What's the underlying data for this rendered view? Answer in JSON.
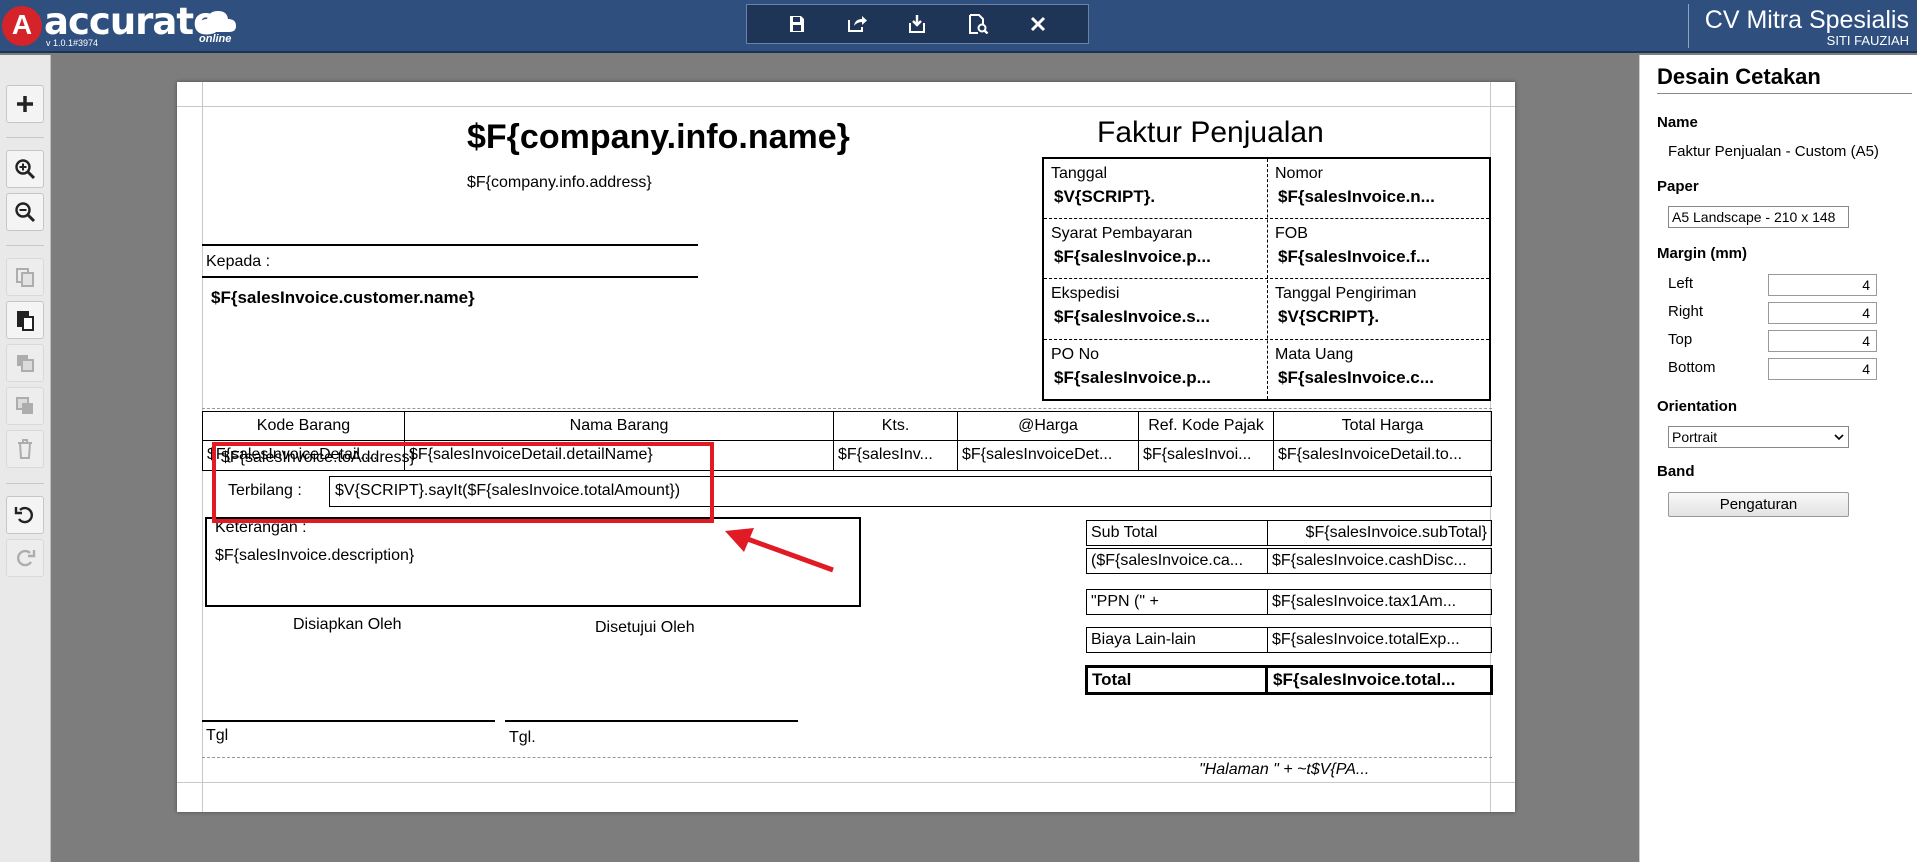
{
  "app": {
    "logo_text": "accurate",
    "logo_mark": "A",
    "version": "v 1.0.1#3974",
    "online": "online",
    "company_name": "CV Mitra Spesialis",
    "user_name": "SITI FAUZIAH"
  },
  "toolbar": {
    "icons": [
      "save-icon",
      "export-icon",
      "import-icon",
      "preview-icon",
      "close-icon"
    ]
  },
  "left_tools": {
    "icons": [
      "add-icon",
      "zoom-in-icon",
      "zoom-out-icon",
      "copy-icon",
      "paste-icon",
      "bring-front-icon",
      "send-back-icon",
      "delete-icon",
      "undo-icon",
      "redo-icon"
    ]
  },
  "doc": {
    "company_name": "$F{company.info.name}",
    "company_address": "$F{company.info.address}",
    "doc_title": "Faktur Penjualan",
    "kepada_label": "Kepada :",
    "customer_name": "$F{salesInvoice.customer.name}",
    "info": [
      {
        "label": "Tanggal",
        "value": "$V{SCRIPT}."
      },
      {
        "label": "Nomor",
        "value": "$F{salesInvoice.n..."
      },
      {
        "label": "Syarat Pembayaran",
        "value": "$F{salesInvoice.p..."
      },
      {
        "label": "FOB",
        "value": "$F{salesInvoice.f..."
      },
      {
        "label": "Ekspedisi",
        "value": "$F{salesInvoice.s..."
      },
      {
        "label": "Tanggal Pengiriman",
        "value": "$V{SCRIPT}."
      },
      {
        "label": "PO No",
        "value": "$F{salesInvoice.p..."
      },
      {
        "label": "Mata Uang",
        "value": "$F{salesInvoice.c..."
      }
    ],
    "table_headers": [
      "Kode Barang",
      "Nama Barang",
      "Kts.",
      "@Harga",
      "Ref. Kode Pajak",
      "Total Harga"
    ],
    "table_row": [
      "$F{salesInvoiceDetail....",
      "$F{salesInvoiceDetail.detailName}",
      "$F{salesInv...",
      "$F{salesInvoiceDet...",
      "$F{salesInvoi...",
      "$F{salesInvoiceDetail.to..."
    ],
    "overlay_text": "$F{salesInvoice.toAddress}",
    "terbilang_label": "Terbilang :",
    "terbilang_value": "$V{SCRIPT}.sayIt($F{salesInvoice.totalAmount})",
    "keterangan_label": "Keterangan :",
    "description": "$F{salesInvoice.description}",
    "disiapkan": "Disiapkan Oleh",
    "disetujui": "Disetujui Oleh",
    "tgl1": "Tgl",
    "tgl2": "Tgl.",
    "summary": [
      {
        "label": "Sub Total",
        "value": "$F{salesInvoice.subTotal}"
      },
      {
        "label": "($F{salesInvoice.ca...",
        "value": "$F{salesInvoice.cashDisc..."
      },
      {
        "label": "\"PPN (\" +",
        "value": "$F{salesInvoice.tax1Am..."
      },
      {
        "label": "Biaya Lain-lain",
        "value": "$F{salesInvoice.totalExp..."
      },
      {
        "label": "Total",
        "value": "$F{salesInvoice.total..."
      }
    ],
    "footer_page": "\"Halaman \" + ~t$V{PA..."
  },
  "panel": {
    "title": "Desain Cetakan",
    "name_label": "Name",
    "name_value": "Faktur Penjualan - Custom (A5)",
    "paper_label": "Paper",
    "paper_value": "A5 Landscape - 210 x 148",
    "margin_label": "Margin (mm)",
    "margins": [
      {
        "label": "Left",
        "value": "4"
      },
      {
        "label": "Right",
        "value": "4"
      },
      {
        "label": "Top",
        "value": "4"
      },
      {
        "label": "Bottom",
        "value": "4"
      }
    ],
    "orientation_label": "Orientation",
    "orientation_value": "Portrait",
    "band_label": "Band",
    "band_button": "Pengaturan"
  },
  "colors": {
    "topbar": "#2f4f7f",
    "highlight": "#e01b24"
  }
}
